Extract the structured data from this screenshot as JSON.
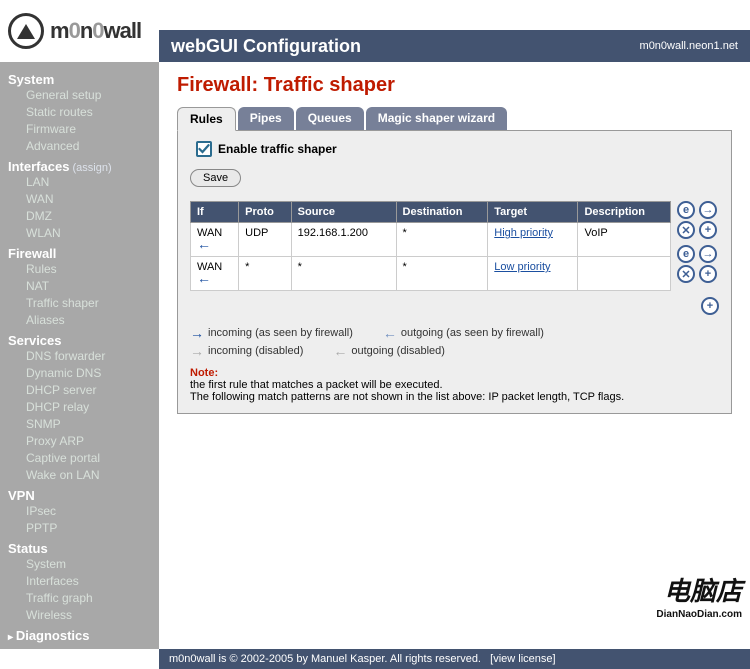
{
  "brand": {
    "name_html": "m0n0wall"
  },
  "header": {
    "title": "webGUI Configuration",
    "host": "m0n0wall.neon1.net"
  },
  "sidebar": [
    {
      "head": "System",
      "items": [
        "General setup",
        "Static routes",
        "Firmware",
        "Advanced"
      ]
    },
    {
      "head": "Interfaces",
      "assign": "(assign)",
      "items": [
        "LAN",
        "WAN",
        "DMZ",
        "WLAN"
      ]
    },
    {
      "head": "Firewall",
      "items": [
        "Rules",
        "NAT",
        "Traffic shaper",
        "Aliases"
      ]
    },
    {
      "head": "Services",
      "items": [
        "DNS forwarder",
        "Dynamic DNS",
        "DHCP server",
        "DHCP relay",
        "SNMP",
        "Proxy ARP",
        "Captive portal",
        "Wake on LAN"
      ]
    },
    {
      "head": "VPN",
      "items": [
        "IPsec",
        "PPTP"
      ]
    },
    {
      "head": "Status",
      "items": [
        "System",
        "Interfaces",
        "Traffic graph",
        "Wireless"
      ]
    }
  ],
  "diag": "Diagnostics",
  "page": {
    "title": "Firewall: Traffic shaper",
    "tabs": [
      "Rules",
      "Pipes",
      "Queues",
      "Magic shaper wizard"
    ],
    "active_tab": 0,
    "enable_label": "Enable traffic shaper",
    "enable_checked": true,
    "save_label": "Save",
    "columns": [
      "If",
      "Proto",
      "Source",
      "Destination",
      "Target",
      "Description"
    ],
    "rows": [
      {
        "if": "WAN",
        "dir": "in",
        "proto": "UDP",
        "source": "192.168.1.200",
        "dest": "*",
        "target": "High priority",
        "desc": "VoIP"
      },
      {
        "if": "WAN",
        "dir": "in",
        "proto": "*",
        "source": "*",
        "dest": "*",
        "target": "Low priority",
        "desc": ""
      }
    ],
    "actions": {
      "e": "e",
      "x": "✕",
      "mv": "→",
      "add": "+"
    },
    "legend": {
      "in_en": "incoming (as seen by firewall)",
      "out_en": "outgoing (as seen by firewall)",
      "in_dis": "incoming (disabled)",
      "out_dis": "outgoing (disabled)"
    },
    "note_head": "Note:",
    "note1": "the first rule that matches a packet will be executed.",
    "note2": "The following match patterns are not shown in the list above: IP packet length, TCP flags."
  },
  "footer": {
    "text": "m0n0wall is © 2002-2005 by Manuel Kasper. All rights reserved.",
    "link": "[view license]"
  },
  "watermark": {
    "big": "电脑店",
    "small": "DianNaoDian.com"
  }
}
